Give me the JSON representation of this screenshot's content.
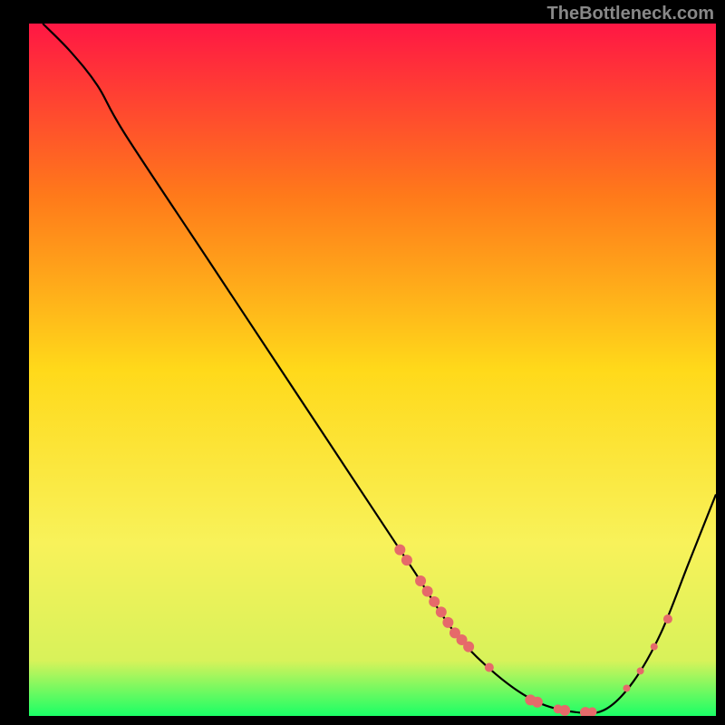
{
  "watermark": "TheBottleneck.com",
  "chart_data": {
    "type": "line",
    "title": "",
    "xlabel": "",
    "ylabel": "",
    "xlim": [
      0,
      100
    ],
    "ylim": [
      0,
      100
    ],
    "gradient_stops": [
      {
        "offset": 0,
        "color": "#ff1744"
      },
      {
        "offset": 25,
        "color": "#ff7a1a"
      },
      {
        "offset": 50,
        "color": "#ffd91a"
      },
      {
        "offset": 75,
        "color": "#f8f25a"
      },
      {
        "offset": 92,
        "color": "#d8f25a"
      },
      {
        "offset": 100,
        "color": "#1aff66"
      }
    ],
    "curve": [
      {
        "x": 2,
        "y": 100
      },
      {
        "x": 6,
        "y": 96
      },
      {
        "x": 10,
        "y": 91
      },
      {
        "x": 14,
        "y": 84
      },
      {
        "x": 26,
        "y": 66
      },
      {
        "x": 38,
        "y": 48
      },
      {
        "x": 50,
        "y": 30
      },
      {
        "x": 56,
        "y": 21
      },
      {
        "x": 62,
        "y": 12
      },
      {
        "x": 68,
        "y": 6
      },
      {
        "x": 74,
        "y": 2
      },
      {
        "x": 80,
        "y": 0.5
      },
      {
        "x": 84,
        "y": 1
      },
      {
        "x": 88,
        "y": 5
      },
      {
        "x": 92,
        "y": 12
      },
      {
        "x": 96,
        "y": 22
      },
      {
        "x": 100,
        "y": 32
      }
    ],
    "markers": [
      {
        "x": 54,
        "y": 24,
        "r": 6
      },
      {
        "x": 55,
        "y": 22.5,
        "r": 6
      },
      {
        "x": 57,
        "y": 19.5,
        "r": 6
      },
      {
        "x": 58,
        "y": 18,
        "r": 6
      },
      {
        "x": 59,
        "y": 16.5,
        "r": 6
      },
      {
        "x": 60,
        "y": 15,
        "r": 6
      },
      {
        "x": 61,
        "y": 13.5,
        "r": 6
      },
      {
        "x": 62,
        "y": 12,
        "r": 6
      },
      {
        "x": 63,
        "y": 11,
        "r": 6
      },
      {
        "x": 64,
        "y": 10,
        "r": 6
      },
      {
        "x": 67,
        "y": 7,
        "r": 5
      },
      {
        "x": 73,
        "y": 2.3,
        "r": 6
      },
      {
        "x": 74,
        "y": 2,
        "r": 6
      },
      {
        "x": 77,
        "y": 1,
        "r": 5
      },
      {
        "x": 78,
        "y": 0.8,
        "r": 6
      },
      {
        "x": 81,
        "y": 0.5,
        "r": 6
      },
      {
        "x": 82,
        "y": 0.6,
        "r": 5
      },
      {
        "x": 87,
        "y": 4,
        "r": 4
      },
      {
        "x": 89,
        "y": 6.5,
        "r": 4
      },
      {
        "x": 91,
        "y": 10,
        "r": 4
      },
      {
        "x": 93,
        "y": 14,
        "r": 5
      }
    ],
    "marker_color": "#e66a6a",
    "curve_color": "#000000"
  }
}
